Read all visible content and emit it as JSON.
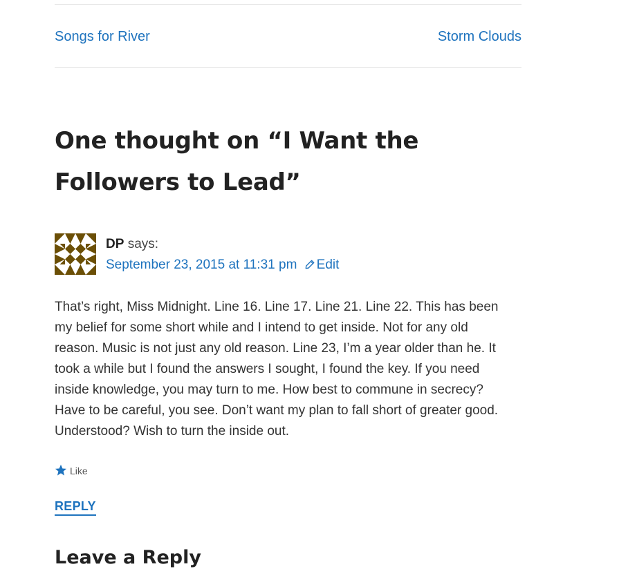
{
  "post_nav": {
    "previous_label": "Songs for River",
    "next_label": "Storm Clouds"
  },
  "comments": {
    "title": "One thought on “I Want the Followers to Lead”",
    "items": [
      {
        "author": "DP",
        "says": "says:",
        "date": "September 23, 2015 at 11:31 pm",
        "edit_label": "Edit",
        "body": "That’s right, Miss Midnight. Line 16. Line 17. Line 21. Line 22. This has been my belief for some short while and I intend to get inside. Not for any old reason. Music is not just any old reason. Line 23, I’m a year older than he. It took a while but I found the answers I sought, I found the key. If you need inside knowledge, you may turn to me. How best to commune in secrecy? Have to be careful, you see. Don’t want my plan to fall short of greater good. Understood? Wish to turn the inside out.",
        "like_label": "Like",
        "reply_label": "REPLY",
        "avatar_color": "#6b4f06"
      }
    ]
  },
  "reply_form": {
    "title": "Leave a Reply"
  },
  "colors": {
    "link": "#1e73be",
    "text": "#333333"
  },
  "icons": {
    "avatar": "identicon-avatar",
    "edit": "pencil-icon",
    "like": "star-icon"
  }
}
